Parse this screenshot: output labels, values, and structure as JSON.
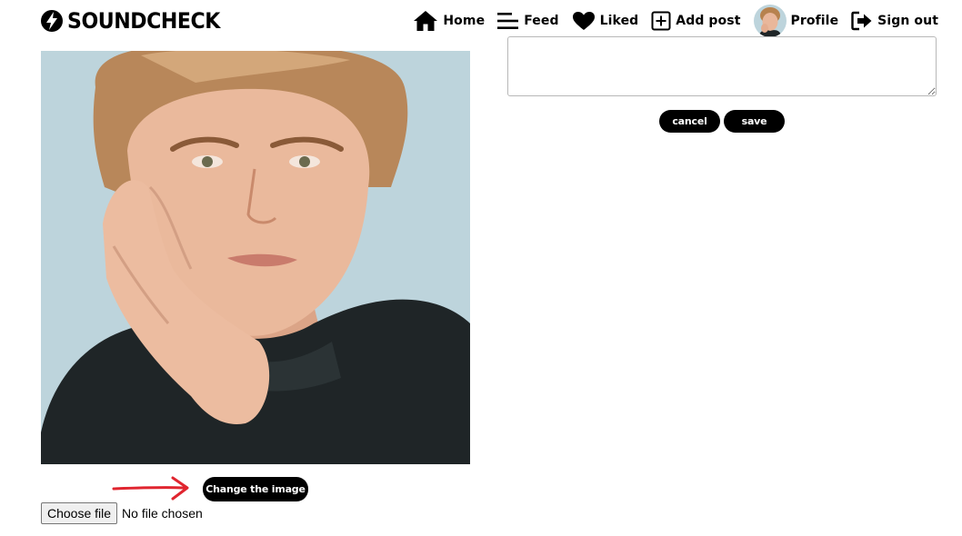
{
  "brand": {
    "name": "SOUNDCHECK"
  },
  "nav": {
    "home": "Home",
    "feed": "Feed",
    "liked": "Liked",
    "add_post": "Add post",
    "profile": "Profile",
    "sign_out": "Sign out"
  },
  "edit": {
    "bio_value": "",
    "cancel_label": "cancel",
    "save_label": "save",
    "change_image_label": "Change the image"
  },
  "file_input": {
    "button_label": "Choose file",
    "status": "No file chosen"
  },
  "colors": {
    "primary": "#000000",
    "button_text": "#ffffff",
    "photo_background": "#bdd4dc",
    "annotation_arrow": "#e0252f"
  },
  "icons": [
    "bolt-logo-icon",
    "home-icon",
    "feed-icon",
    "heart-icon",
    "add-post-icon",
    "sign-out-icon"
  ]
}
